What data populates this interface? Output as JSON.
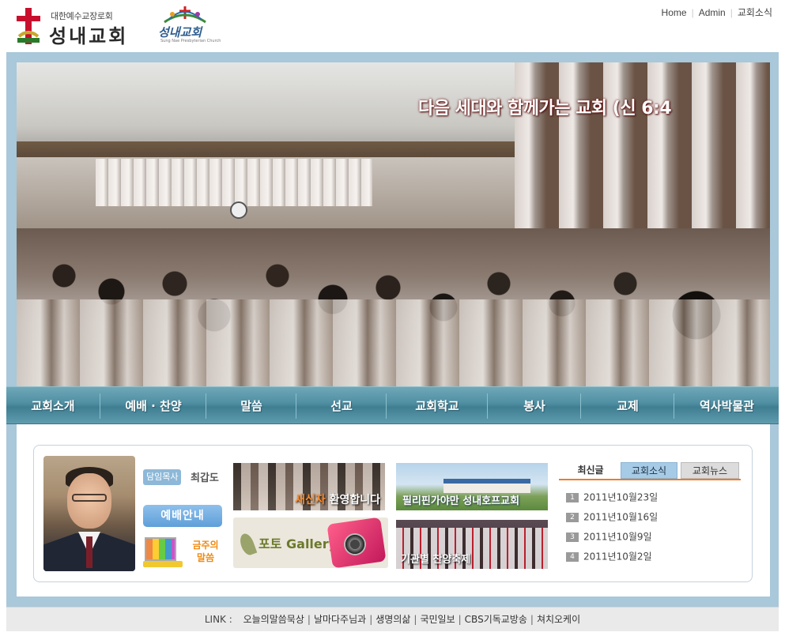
{
  "header": {
    "logo_sub": "대한예수교장로회",
    "logo_main": "성내교회",
    "logo2_text": "성내교회",
    "logo2_eng": "Sung Nae Presbyterian Church",
    "topnav": [
      "Home",
      "Admin",
      "교회소식"
    ]
  },
  "hero": {
    "caption": "다음 세대와 함께가는 교회 (신 6:4"
  },
  "menu": [
    "교회소개",
    "예배 · 찬양",
    "말씀",
    "선교",
    "교회학교",
    "봉사",
    "교제",
    "역사박물관"
  ],
  "pastor": {
    "tag": "담임목사",
    "name": "최갑도"
  },
  "worship_button": "예배안내",
  "sermon": {
    "line1": "금주의",
    "line2": "말씀"
  },
  "banners": {
    "newcomer_highlight": "새신자",
    "newcomer_rest": " 환영합니다",
    "gallery": "포토 Gallery",
    "mission": "필리핀가야만 성내호프교회",
    "choir": "기관별 찬양축제"
  },
  "tabs": [
    "최신글",
    "교회소식",
    "교회뉴스"
  ],
  "news": [
    {
      "num": "1",
      "date": "2011년10월23일"
    },
    {
      "num": "2",
      "date": "2011년10월16일"
    },
    {
      "num": "3",
      "date": "2011년10월9일"
    },
    {
      "num": "4",
      "date": "2011년10월2일"
    }
  ],
  "footer": {
    "label": "LINK :",
    "links": [
      "오늘의말씀묵상",
      "날마다주님과",
      "생명의삶",
      "국민일보",
      "CBS기독교방송",
      "쳐치오케이"
    ]
  },
  "colors": {
    "frame": "#a9c8d9",
    "menubar": "#4f8ea2",
    "tab_active": "#a6cbe7",
    "accent_orange": "#f07a2a",
    "worship_button": "#6fa9dd"
  }
}
